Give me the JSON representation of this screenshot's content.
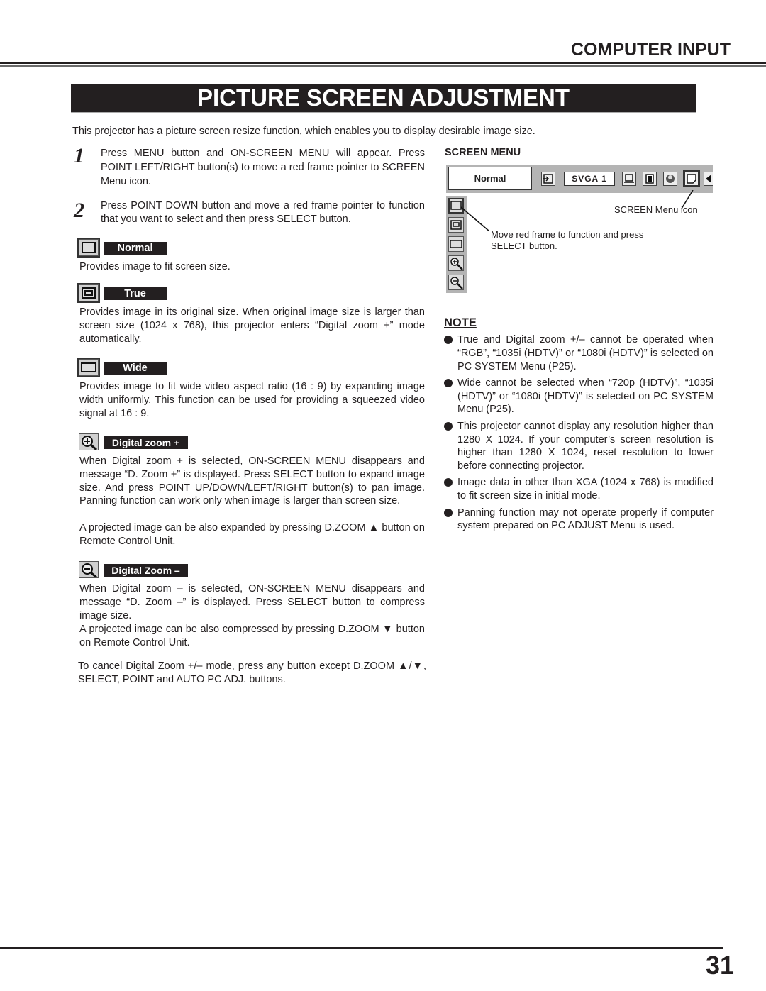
{
  "header": {
    "section": "COMPUTER INPUT",
    "title": "PICTURE SCREEN ADJUSTMENT"
  },
  "intro": "This projector has a picture screen resize function, which enables you to display desirable image size.",
  "steps": [
    {
      "number": "1",
      "text": "Press MENU button and ON-SCREEN MENU will appear.  Press POINT LEFT/RIGHT button(s) to move a red frame pointer to SCREEN Menu icon."
    },
    {
      "number": "2",
      "text": "Press POINT DOWN button and move a red frame pointer to function that you want to select and then press SELECT button."
    }
  ],
  "modes": [
    {
      "label": "Normal",
      "icon": "normal-screen-icon",
      "paragraphs": [
        "Provides image to fit screen size."
      ]
    },
    {
      "label": "True",
      "icon": "true-screen-icon",
      "paragraphs": [
        "Provides image in its original size.  When original image size is larger than screen size (1024 x 768), this projector enters “Digital zoom +” mode automatically."
      ]
    },
    {
      "label": "Wide",
      "icon": "wide-screen-icon",
      "paragraphs": [
        "Provides image to fit wide video aspect ratio (16 : 9) by expanding image width uniformly.  This function can be used for providing a squeezed video signal at 16 : 9."
      ]
    },
    {
      "label": "Digital zoom +",
      "icon": "zoom-in-icon",
      "paragraphs": [
        "When Digital zoom + is selected, ON-SCREEN MENU disappears and message “D. Zoom +” is displayed.  Press SELECT button to expand image size.  And press POINT UP/DOWN/LEFT/RIGHT button(s) to pan image.  Panning function can work only when image is larger than screen size.",
        "A projected image can be also expanded by pressing D.ZOOM ▲ button on Remote Control Unit."
      ]
    },
    {
      "label": "Digital Zoom –",
      "icon": "zoom-out-icon",
      "paragraphs": [
        "When Digital zoom – is selected, ON-SCREEN MENU disappears and message “D. Zoom –” is displayed.  Press SELECT button to compress image size.",
        "A projected image can be also compressed by pressing D.ZOOM ▼ button on Remote Control Unit."
      ]
    }
  ],
  "cancel_note": "To cancel Digital Zoom +/– mode, press any button except D.ZOOM ▲/▼, SELECT, POINT and AUTO PC ADJ. buttons.",
  "screen_menu": {
    "heading": "SCREEN MENU",
    "current_mode": "Normal",
    "source": "SVGA 1",
    "icon_caption": "SCREEN Menu icon",
    "pointer_caption": "Move red frame to function and press SELECT button."
  },
  "note": {
    "title": "NOTE",
    "items": [
      "True and Digital zoom +/– cannot be operated when “RGB”, “1035i (HDTV)” or “1080i (HDTV)” is selected on PC SYSTEM Menu  (P25).",
      "Wide cannot be selected when “720p (HDTV)”, “1035i (HDTV)” or “1080i (HDTV)” is selected on PC SYSTEM Menu  (P25).",
      "This projector cannot display any resolution higher than 1280 X 1024.  If your computer’s screen resolution is higher than 1280 X 1024, reset resolution to lower before connecting projector.",
      "Image data in other than XGA (1024 x 768) is modified to fit screen size in initial mode.",
      "Panning function may not operate properly if computer system prepared on PC ADJUST Menu is used."
    ]
  },
  "page_number": "31"
}
